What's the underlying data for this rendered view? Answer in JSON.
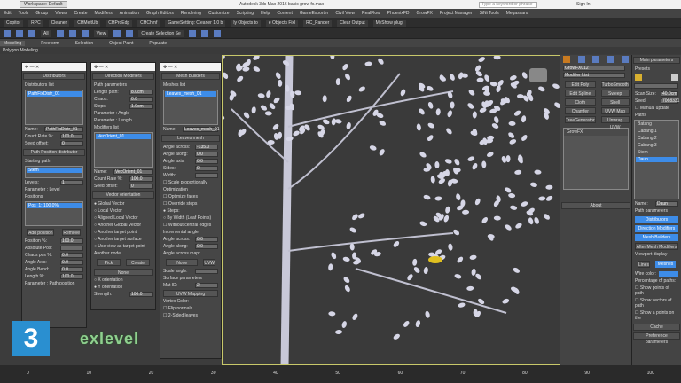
{
  "titlebar": {
    "workspace": "Workspace: Default",
    "title": "Autodesk 3ds Max 2016    basic grow fx.max",
    "search_placeholder": "Type a keyword or phrase",
    "sign_in": "Sign In"
  },
  "menu": [
    "Edit",
    "Tools",
    "Group",
    "Views",
    "Create",
    "Modifiers",
    "Animation",
    "Graph Editors",
    "Rendering",
    "Customize",
    "Scripting",
    "Help",
    "Content",
    "GameExporter",
    "Civil View",
    "RealFlow",
    "PhoenixFD",
    "GrowFX",
    "Project Manager",
    "SiNi Tools",
    "Megascans"
  ],
  "toolbar1": [
    "Copitor",
    "RPC",
    "Cleaner",
    "CHMeltUb",
    "CHProEdp",
    "CHChmf",
    "GameSetting: Cleaner 1.0 b",
    "ly Objects to",
    "e Objects Fixl",
    "RC_Pander",
    "Clear Output",
    "MyShow plugi"
  ],
  "toolbar2": {
    "selection_filter": "All",
    "coord": "View",
    "named_selection": "Create Selection Se"
  },
  "ribbon": {
    "tabs": [
      "Modeling",
      "Freeform",
      "Selection",
      "Object Paint",
      "Populate"
    ],
    "sub": "Polygon Modeling"
  },
  "distributors": {
    "title": "Distributors",
    "list_label": "Distributors list",
    "items": [
      "PathFixDistr_01"
    ],
    "name_label": "Name:",
    "name": "PathFixDistr_01",
    "count_label": "Count Rate %:",
    "count": "100.0",
    "seed_label": "Seed offset:",
    "seed": "0",
    "ppd_title": "Path Position distributor",
    "start_label": "Starting path",
    "start_item": "Stem",
    "levels_label": "Levels:",
    "levels": "1",
    "param_level": "Parameter : Level",
    "positions_label": "Positions",
    "positions_item": "Pos_1: 100.0%",
    "add_position": "Add position",
    "remove": "Remove",
    "position_pct": "Position %:",
    "position_val": "100.0",
    "abs_pos": "Absolute Pos:",
    "chaos_pos": "Chaos pos %:",
    "chaos_pos_val": "0.0",
    "angle_axis": "Angle Axis:",
    "angle_axis_val": "0.0",
    "angle_bend": "Angle Bend:",
    "angle_bend_val": "0.0",
    "length_pct": "Length %:",
    "length_val": "100.0",
    "param_path_pos": "Parameter : Path position"
  },
  "direction": {
    "title": "Direction Modifiers",
    "path_params": "Path parameters",
    "length_label": "Length path:",
    "length": "8.0cm",
    "chaos_label": "Chaos:",
    "chaos": "0.0",
    "steps_label": "Steps:",
    "steps": "1.0cm",
    "param_angle": "Parameter : Angle",
    "param_length": "Parameter : Length",
    "mod_list": "Modifiers list",
    "items": [
      "VecOrient_01"
    ],
    "name_label": "Name:",
    "name": "VecOrient_01",
    "count_label": "Count Rate %:",
    "count": "100.0",
    "seed_label": "Seed offset:",
    "seed": "0",
    "vo_title": "Vector orientation",
    "options": [
      "Global Vector",
      "Local Vector",
      "Aligned Local Vector",
      "Another Global Vector",
      "Another target point",
      "Another target surface",
      "Use view as target point"
    ],
    "another_node": "Another node",
    "pick": "Pick",
    "create": "Create",
    "none": "None",
    "x_orient": "X orientation",
    "y_orient": "Y orientation",
    "strength_label": "Strength:",
    "strength": "100.0"
  },
  "mesh": {
    "title": "Mesh Builders",
    "list_label": "Meshes list",
    "items": [
      "Leaves_mesh_01"
    ],
    "name_label": "Name:",
    "name": "Leaves_mesh_01",
    "leaves_title": "Leaves mesh",
    "angle_across": "Angle across:",
    "angle_across_val": "-135.0",
    "angle_along": "Angle along:",
    "angle_along_val": "0.0",
    "angle_axis": "Angle axis:",
    "angle_axis_val": "0.0",
    "sides": "Sides:",
    "sides_val": "0",
    "width": "Width:",
    "scale_prop": "Scale proportionally",
    "optimization": "Optimization",
    "optimize_faces": "Optimize faces",
    "override_steps": "Override steps",
    "steps": "Steps:",
    "by_width": "By Width (Leaf Points)",
    "without_edges": "Without central edges",
    "incremental": "Incremental angle",
    "inc_across": "Angle across:",
    "inc_along": "Angle along:",
    "angle_map": "Angle across map:",
    "none": "None",
    "uvw": "UVW",
    "scale_angle": "Scale angle:",
    "surface": "Surface parameters",
    "mat_id": "Mat ID:",
    "mat_id_val": "2",
    "uvw_mapping": "UVW Mapping",
    "vertex_color": "Vertex Color:",
    "flip_normals": "Flip normals",
    "two_sided": "2-Sided leaves"
  },
  "command_panel": {
    "object_name": "GrowFX012",
    "modifier_list": "Modifier List",
    "buttons": [
      "Edit Poly",
      "TurboSmooth",
      "Edit Spline",
      "Sweep",
      "Cloth",
      "Shell",
      "Chamfer",
      "UVW Map",
      "TreeGenerator",
      "Unwrap UVW"
    ],
    "stack": [
      "GrowFX"
    ],
    "rollout": "About"
  },
  "main_params": {
    "title": "Main parameters",
    "presets": "Presets",
    "scan_size_label": "Scan Size:",
    "scan_size": "40.0cm",
    "seed_label": "Seed:",
    "seed": "7068331",
    "manual_update": "Manual update",
    "paths_label": "Paths",
    "paths": [
      "Batang",
      "Cabang 1",
      "Cabang 2",
      "Cabang 3",
      "Stem",
      "Daun"
    ],
    "name_label": "Name:",
    "name": "Daun",
    "path_params": "Path parameters",
    "path_buttons": [
      "Distributors",
      "Direction Modifiers",
      "Mesh Builders"
    ],
    "after_mesh": "After Mesh Modifiers",
    "viewport_display": "Viewport display",
    "lines": "Lines",
    "meshes": "Meshes",
    "wire_color": "Wire color:",
    "pct_paths": "Percentage of paths:",
    "show1": "Show points of path",
    "show2": "Show vectors of path",
    "show3": "Show a points on the",
    "cache": "Cache",
    "preference": "Preference parameters"
  },
  "watermark": {
    "number": "3",
    "brand": "exlevel"
  },
  "timeline": [
    "0",
    "10",
    "20",
    "30",
    "40",
    "50",
    "60",
    "70",
    "80",
    "90",
    "100"
  ]
}
